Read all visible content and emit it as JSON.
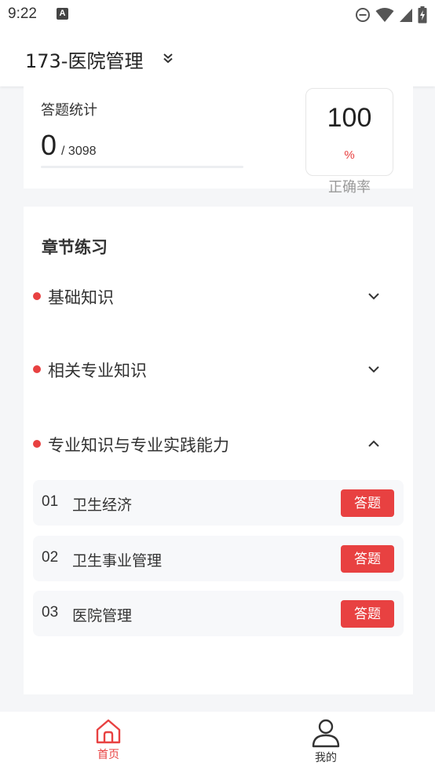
{
  "status": {
    "time": "9:22",
    "notification_icon": "A"
  },
  "header": {
    "title": "173-医院管理"
  },
  "stats": {
    "label": "答题统计",
    "done": "0",
    "total": "/ 3098",
    "progress_fraction": 0,
    "accuracy_value": "100",
    "accuracy_unit": "%",
    "accuracy_label": "正确率"
  },
  "chapters": {
    "title": "章节练习",
    "sections": [
      {
        "label": "基础知识",
        "expanded": false
      },
      {
        "label": "相关专业知识",
        "expanded": false
      },
      {
        "label": "专业知识与专业实践能力",
        "expanded": true
      }
    ],
    "items": [
      {
        "num": "01",
        "label": "卫生经济",
        "button": "答题"
      },
      {
        "num": "02",
        "label": "卫生事业管理",
        "button": "答题"
      },
      {
        "num": "03",
        "label": "医院管理",
        "button": "答题"
      }
    ]
  },
  "tabs": [
    {
      "label": "首页",
      "icon": "home-icon",
      "active": true
    },
    {
      "label": "我的",
      "icon": "user-icon",
      "active": false
    }
  ],
  "colors": {
    "accent": "#e84141",
    "inactive": "#333333"
  }
}
